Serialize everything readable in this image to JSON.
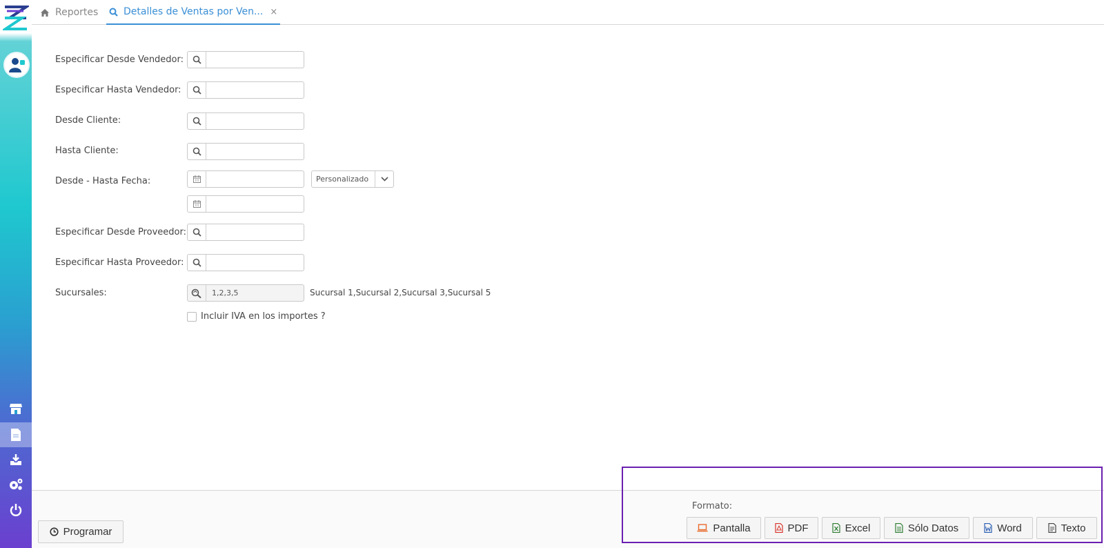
{
  "sidebar": {
    "items": [
      {
        "icon": "store-icon"
      },
      {
        "icon": "document-icon",
        "active": true
      },
      {
        "icon": "download-tray-icon"
      },
      {
        "icon": "gears-icon"
      },
      {
        "icon": "power-icon"
      }
    ]
  },
  "tabs": [
    {
      "label": "Reportes",
      "icon": "home-icon"
    },
    {
      "label": "Detalles de Ventas por Ven...",
      "icon": "search-icon",
      "close": "×"
    }
  ],
  "form": {
    "desde_vendedor": {
      "label": "Especificar Desde Vendedor:",
      "value": ""
    },
    "hasta_vendedor": {
      "label": "Especificar Hasta Vendedor:",
      "value": ""
    },
    "desde_cliente": {
      "label": "Desde Cliente:",
      "value": ""
    },
    "hasta_cliente": {
      "label": "Hasta Cliente:",
      "value": ""
    },
    "fecha": {
      "label": "Desde - Hasta Fecha:",
      "desde": "",
      "hasta": "",
      "periodo": "Personalizado"
    },
    "desde_proveedor": {
      "label": "Especificar Desde Proveedor:",
      "value": ""
    },
    "hasta_proveedor": {
      "label": "Especificar Hasta Proveedor:",
      "value": ""
    },
    "sucursales": {
      "label": "Sucursales:",
      "value": "1,2,3,5",
      "description": "Sucursal 1,Sucursal 2,Sucursal 3,Sucursal 5"
    },
    "incluir_iva": {
      "label": "Incluir IVA en los importes ?",
      "checked": false
    }
  },
  "footer": {
    "programar_label": "Programar",
    "formato_label": "Formato:",
    "buttons": [
      {
        "label": "Pantalla",
        "icon": "laptop-icon",
        "color": "#e8692b"
      },
      {
        "label": "PDF",
        "icon": "pdf-icon",
        "color": "#d9342b"
      },
      {
        "label": "Excel",
        "icon": "excel-icon",
        "color": "#2e7d32"
      },
      {
        "label": "Sólo Datos",
        "icon": "data-file-icon",
        "color": "#2e7d32"
      },
      {
        "label": "Word",
        "icon": "word-icon",
        "color": "#2b5fb4"
      },
      {
        "label": "Texto",
        "icon": "text-file-icon",
        "color": "#444444"
      }
    ]
  },
  "colors": {
    "accent": "#3a8fd6",
    "highlight": "#6a1fb0"
  }
}
